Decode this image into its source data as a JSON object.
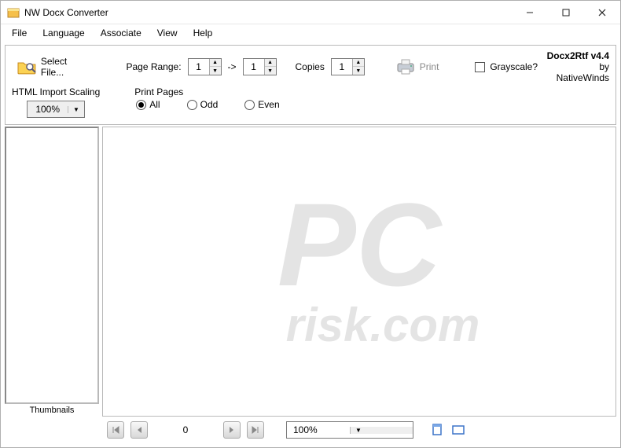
{
  "titlebar": {
    "title": "NW Docx Converter"
  },
  "menu": {
    "file": "File",
    "language": "Language",
    "associate": "Associate",
    "view": "View",
    "help": "Help"
  },
  "toolbar": {
    "select_file": "Select File...",
    "page_range_label": "Page Range:",
    "page_from": "1",
    "page_to": "1",
    "arrow": "->",
    "copies_label": "Copies",
    "copies_value": "1",
    "print_label": "Print",
    "grayscale_label": "Grayscale?",
    "brand_name": "Docx2Rtf v4.4",
    "brand_by": "by NativeWinds",
    "html_scaling_label": "HTML Import Scaling",
    "html_scaling_value": "100%",
    "print_pages_label": "Print Pages",
    "radio_all": "All",
    "radio_odd": "Odd",
    "radio_even": "Even"
  },
  "thumbs": {
    "label": "Thumbnails"
  },
  "footer": {
    "page_number": "0",
    "zoom": "100%"
  }
}
